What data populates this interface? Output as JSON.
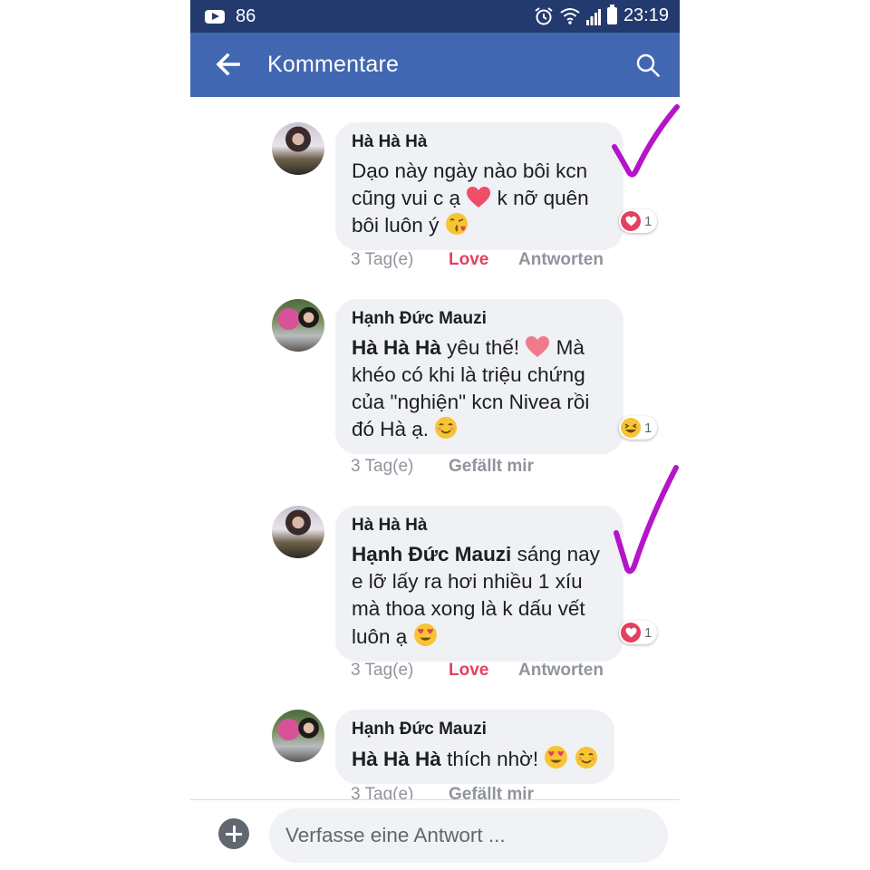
{
  "status_bar": {
    "notification_count": "86",
    "time": "23:19"
  },
  "header": {
    "title": "Kommentare"
  },
  "comments": [
    {
      "author": "Hà Hà Hà",
      "text_parts": [
        "Dạo này ngày nào bôi kcn",
        "cũng vui c ạ",
        "k nỡ quên",
        "bôi luôn ý"
      ],
      "reaction_count": "1",
      "time": "3 Tag(e)",
      "action_like": "Love",
      "action_reply": "Antworten"
    },
    {
      "author": "Hạnh Đức Mauzi",
      "mention": "Hà Hà Hà",
      "text_parts": [
        "yêu thế!",
        "Mà",
        "khéo có khi là triệu chứng",
        "của \"nghiện\" kcn Nivea rồi",
        "đó Hà ạ."
      ],
      "reaction_count": "1",
      "time": "3 Tag(e)",
      "action_like": "Gefällt mir"
    },
    {
      "author": "Hà Hà Hà",
      "mention": "Hạnh Đức Mauzi",
      "text_parts": [
        "sáng nay",
        "e lỡ lấy ra hơi nhiều 1 xíu",
        "mà thoa xong là k dấu vết",
        "luôn ạ"
      ],
      "reaction_count": "1",
      "time": "3 Tag(e)",
      "action_like": "Love",
      "action_reply": "Antworten"
    },
    {
      "author": "Hạnh Đức Mauzi",
      "mention": "Hà Hà Hà",
      "text_parts": [
        "thích nhờ!"
      ],
      "time": "3 Tag(e)",
      "action_like": "Gefällt mir"
    }
  ],
  "composer": {
    "placeholder": "Verfasse eine Antwort ..."
  },
  "colors": {
    "header": "#4267b2",
    "status_bar": "#233a6e",
    "love": "#e4405f",
    "checkmark": "#b514c8"
  },
  "icons": [
    "youtube-icon",
    "alarm-icon",
    "wifi-icon",
    "signal-icon",
    "battery-icon",
    "back-arrow-icon",
    "search-icon",
    "plus-icon"
  ]
}
